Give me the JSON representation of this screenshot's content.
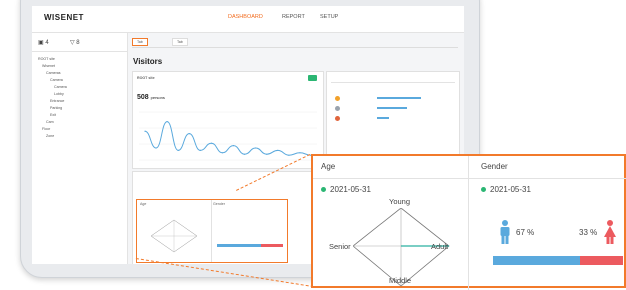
{
  "app": {
    "logo": "WISENET",
    "nav": [
      "DASHBOARD",
      "REPORT",
      "SETUP"
    ],
    "active_nav": "DASHBOARD",
    "accent": "#f26b1d"
  },
  "sidebar": {
    "stat1": "4",
    "stat2": "8",
    "tree": [
      "ROOT site",
      "Wisenet",
      "Cameras",
      "Camera",
      "Camera",
      "Lobby",
      "Entrance",
      "Parking",
      "Exit",
      "Cam",
      "Floor",
      "Zone"
    ]
  },
  "main": {
    "tabs": [
      "Tab",
      "Tab"
    ],
    "page_title": "Visitors",
    "chart_card": {
      "title": "ROOT site",
      "value": "508",
      "unit": "persons"
    },
    "rank_card": {
      "rows": [
        "",
        "",
        ""
      ]
    }
  },
  "zoom": {
    "age": {
      "header": "Age",
      "date": "2021-05-31",
      "labels": {
        "top": "Young",
        "left": "Senior",
        "right": "Adult",
        "bottom": "Middle"
      }
    },
    "gender": {
      "header": "Gender",
      "date": "2021-05-31",
      "male_pct": "67 %",
      "female_pct": "33 %",
      "male_fraction": 0.67,
      "male_color": "#5aa9dd",
      "female_color": "#ec5a5f"
    }
  },
  "chart_data": {
    "type": "line",
    "x": [
      0,
      1,
      2,
      3,
      4,
      5,
      6,
      7,
      8,
      9,
      10,
      11,
      12,
      13,
      14,
      15
    ],
    "values": [
      60,
      25,
      80,
      20,
      55,
      20,
      35,
      15,
      30,
      12,
      25,
      12,
      20,
      10,
      15,
      10
    ],
    "title": "",
    "xlabel": "",
    "ylabel": ""
  }
}
